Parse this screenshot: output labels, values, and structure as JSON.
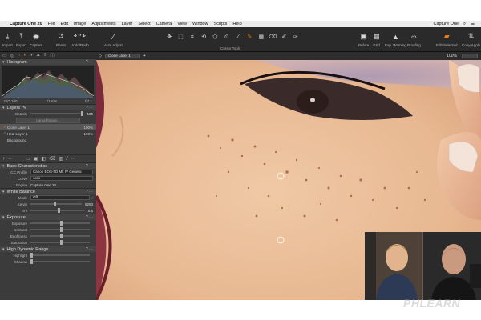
{
  "menubar": {
    "app_name": "Capture One 20",
    "items": [
      "File",
      "Edit",
      "Image",
      "Adjustments",
      "Layer",
      "Select",
      "Camera",
      "View",
      "Window",
      "Scripts",
      "Help"
    ],
    "right_app": "Capture One"
  },
  "toolbar": {
    "left_buttons": [
      {
        "label": "Import",
        "icon": "import-icon"
      },
      {
        "label": "Export",
        "icon": "export-icon"
      },
      {
        "label": "Capture",
        "icon": "capture-icon"
      },
      {
        "label": "Reset",
        "icon": "reset-icon"
      },
      {
        "label": "Undo/Redo",
        "icon": "undo-redo-icon"
      },
      {
        "label": "Auto Adjust",
        "icon": "wand-icon"
      }
    ],
    "cursor_tools_label": "Cursor Tools",
    "right_buttons": [
      {
        "label": "Before",
        "icon": "before-after-icon"
      },
      {
        "label": "Grid",
        "icon": "grid-icon"
      },
      {
        "label": "Exp. Warning",
        "icon": "warning-icon"
      },
      {
        "label": "Proofing",
        "icon": "proofing-icon"
      },
      {
        "label": "Edit Selected",
        "icon": "edit-selected-icon"
      },
      {
        "label": "Copy/Apply",
        "icon": "copy-apply-icon"
      }
    ],
    "accent_color": "#f07d1a"
  },
  "left_panel": {
    "histogram": {
      "title": "Histogram",
      "iso": "ISO 100",
      "shutter": "1/160 s",
      "aperture": "f/7.1"
    },
    "layers": {
      "title": "Layers",
      "opacity_label": "Opacity",
      "opacity_value": "100",
      "luma_button": "Luma Range...",
      "items": [
        {
          "name": "Clone Layer 1",
          "opacity": "100%",
          "selected": true
        },
        {
          "name": "Heal Layer 1",
          "opacity": "100%",
          "selected": false
        },
        {
          "name": "Background",
          "opacity": "",
          "selected": false
        }
      ]
    },
    "base_characteristics": {
      "title": "Base Characteristics",
      "icc_label": "ICC Profile",
      "icc_value": "Canon EOS-5D Mk IV Generic",
      "curve_label": "Curve",
      "curve_value": "Auto",
      "engine_label": "Engine",
      "engine_value": "Capture One 20"
    },
    "white_balance": {
      "title": "White Balance",
      "mode_label": "Mode",
      "mode_value": "Off",
      "kelvin_label": "Kelvin",
      "kelvin_value": "5293",
      "tint_label": "Tint",
      "tint_value": "0.6"
    },
    "exposure": {
      "title": "Exposure",
      "rows": [
        "Exposure",
        "Contrast",
        "Brightness",
        "Saturation"
      ]
    },
    "hdr": {
      "title": "High Dynamic Range",
      "rows": [
        "Highlight",
        "Shadow"
      ]
    }
  },
  "viewer": {
    "layer_dropdown": "Clone Layer 1",
    "zoom": "100%"
  },
  "watermark": "PHLEARN"
}
